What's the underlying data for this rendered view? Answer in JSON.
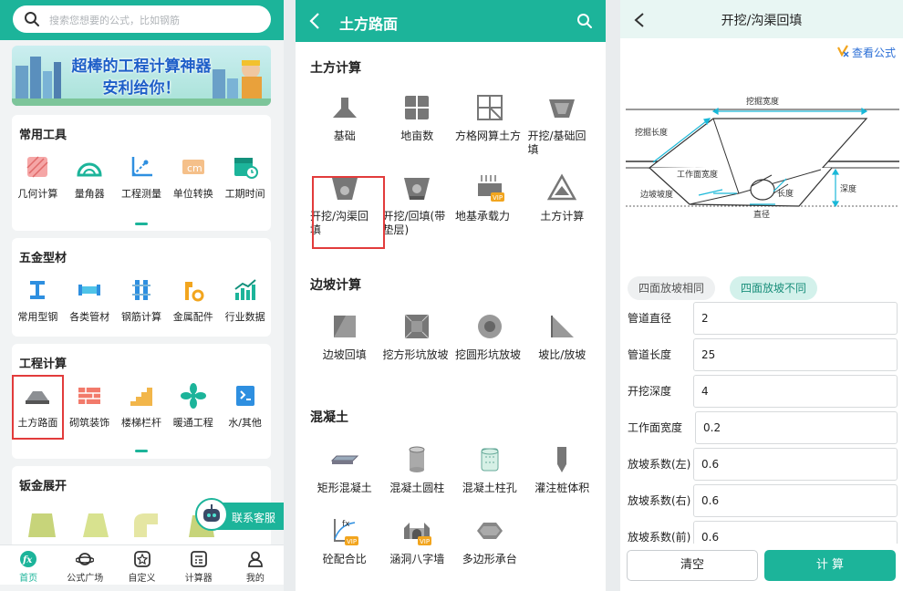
{
  "home": {
    "search_placeholder": "搜索您想要的公式，比如钢筋",
    "banner_line1": "超棒的工程计算神器",
    "banner_line2": "安利给你！",
    "common_tools": {
      "title": "常用工具",
      "items": [
        "几何计算",
        "量角器",
        "工程测量",
        "单位转换",
        "工期时间"
      ]
    },
    "hardware": {
      "title": "五金型材",
      "items": [
        "常用型钢",
        "各类管材",
        "钢筋计算",
        "金属配件",
        "行业数据"
      ]
    },
    "engineering": {
      "title": "工程计算",
      "items": [
        "土方路面",
        "砌筑装饰",
        "楼梯栏杆",
        "暖通工程",
        "水/其他"
      ]
    },
    "sheet_metal": {
      "title": "钣金展开"
    },
    "customer_service": "联系客服",
    "tabs": [
      "首页",
      "公式广场",
      "自定义",
      "计算器",
      "我的"
    ],
    "colors": {
      "accent": "#1cb49a",
      "highlight": "#e23b3b"
    }
  },
  "earthwork": {
    "title": "土方路面",
    "sections": [
      {
        "title": "土方计算",
        "items": [
          "基础",
          "地亩数",
          "方格网算土方",
          "开挖/基础回填",
          "开挖/沟渠回填",
          "开挖/回填(带垫层)",
          "地基承载力",
          "土方计算"
        ]
      },
      {
        "title": "边坡计算",
        "items": [
          "边坡回填",
          "挖方形坑放坡",
          "挖圆形坑放坡",
          "坡比/放坡"
        ]
      },
      {
        "title": "混凝土",
        "items": [
          "矩形混凝土",
          "混凝土圆柱",
          "混凝土柱孔",
          "灌注桩体积",
          "砼配合比",
          "涵洞八字墙",
          "多边形承台"
        ]
      }
    ],
    "vip_badge": "VIP"
  },
  "trench": {
    "title": "开挖/沟渠回填",
    "formula_link": "查看公式",
    "diagram_labels": {
      "width": "挖掘宽度",
      "length": "挖掘长度",
      "work_width": "工作面宽度",
      "slope": "边坡坡度",
      "pipe_length": "长度",
      "depth": "深度",
      "diameter": "直径"
    },
    "segments": [
      "四面放坡相同",
      "四面放坡不同"
    ],
    "fields": [
      {
        "label": "管道直径",
        "value": "2"
      },
      {
        "label": "管道长度",
        "value": "25"
      },
      {
        "label": "开挖深度",
        "value": "4"
      },
      {
        "label": "工作面宽度",
        "value": "0.2"
      },
      {
        "label": "放坡系数(左)",
        "value": "0.6"
      },
      {
        "label": "放坡系数(右)",
        "value": "0.6"
      },
      {
        "label": "放坡系数(前)",
        "value": "0.6"
      }
    ],
    "clear_label": "清空",
    "calc_label": "计 算"
  }
}
